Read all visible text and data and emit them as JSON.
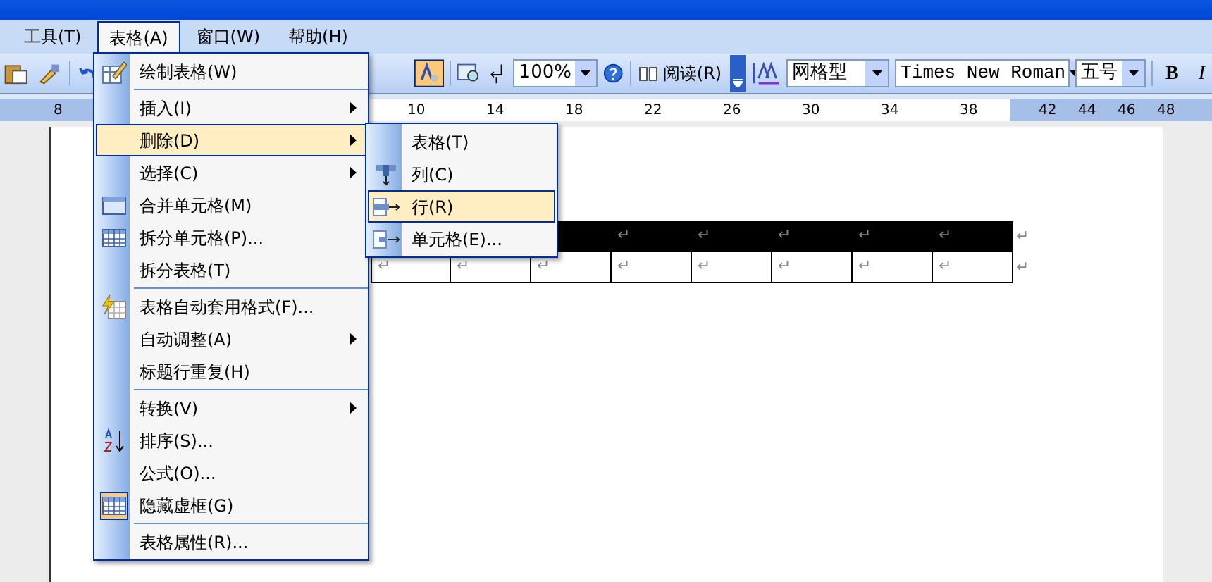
{
  "menubar": [
    {
      "label": "工具(T)",
      "selected": false
    },
    {
      "label": "表格(A)",
      "selected": true
    },
    {
      "label": "窗口(W)",
      "selected": false
    },
    {
      "label": "帮助(H)",
      "selected": false
    }
  ],
  "toolbar": {
    "zoom": "100%",
    "read_button": "阅读(R)",
    "style": "网格型",
    "font": "Times New Roman",
    "size": "五号",
    "bold": "B",
    "italic": "I"
  },
  "ruler": [
    "8",
    "10",
    "14",
    "18",
    "22",
    "26",
    "30",
    "34",
    "38",
    "42",
    "44",
    "46",
    "48"
  ],
  "table": {
    "rows": [
      {
        "header": true,
        "cells": [
          "",
          "",
          "",
          "↵",
          "↵",
          "↵",
          "↵",
          "↵"
        ],
        "end": "↵"
      },
      {
        "header": false,
        "cells": [
          "↵",
          "↵",
          "↵",
          "↵",
          "↵",
          "↵",
          "↵",
          "↵"
        ],
        "end": "↵"
      }
    ]
  },
  "menu": {
    "items": [
      {
        "kind": "item",
        "label": "绘制表格(W)",
        "submenu": false,
        "selected": false,
        "checked": false
      },
      {
        "kind": "separator"
      },
      {
        "kind": "item",
        "label": "插入(I)",
        "submenu": true,
        "selected": false,
        "checked": false
      },
      {
        "kind": "item",
        "label": "删除(D)",
        "submenu": true,
        "selected": true,
        "checked": false
      },
      {
        "kind": "item",
        "label": "选择(C)",
        "submenu": true,
        "selected": false,
        "checked": false
      },
      {
        "kind": "item",
        "label": "合并单元格(M)",
        "submenu": false,
        "selected": false,
        "checked": false
      },
      {
        "kind": "item",
        "label": "拆分单元格(P)...",
        "submenu": false,
        "selected": false,
        "checked": false
      },
      {
        "kind": "item",
        "label": "拆分表格(T)",
        "submenu": false,
        "selected": false,
        "checked": false
      },
      {
        "kind": "separator"
      },
      {
        "kind": "item",
        "label": "表格自动套用格式(F)...",
        "submenu": false,
        "selected": false,
        "checked": false
      },
      {
        "kind": "item",
        "label": "自动调整(A)",
        "submenu": true,
        "selected": false,
        "checked": false
      },
      {
        "kind": "item",
        "label": "标题行重复(H)",
        "submenu": false,
        "selected": false,
        "checked": false
      },
      {
        "kind": "separator"
      },
      {
        "kind": "item",
        "label": "转换(V)",
        "submenu": true,
        "selected": false,
        "checked": false
      },
      {
        "kind": "item",
        "label": "排序(S)...",
        "submenu": false,
        "selected": false,
        "checked": false
      },
      {
        "kind": "item",
        "label": "公式(O)...",
        "submenu": false,
        "selected": false,
        "checked": false
      },
      {
        "kind": "item",
        "label": "隐藏虚框(G)",
        "submenu": false,
        "selected": false,
        "checked": true
      },
      {
        "kind": "separator"
      },
      {
        "kind": "item",
        "label": "表格属性(R)...",
        "submenu": false,
        "selected": false,
        "checked": false
      }
    ]
  },
  "submenu": {
    "items": [
      {
        "label": "表格(T)",
        "selected": false
      },
      {
        "label": "列(C)",
        "selected": false
      },
      {
        "label": "行(R)",
        "selected": true
      },
      {
        "label": "单元格(E)...",
        "selected": false
      }
    ]
  }
}
